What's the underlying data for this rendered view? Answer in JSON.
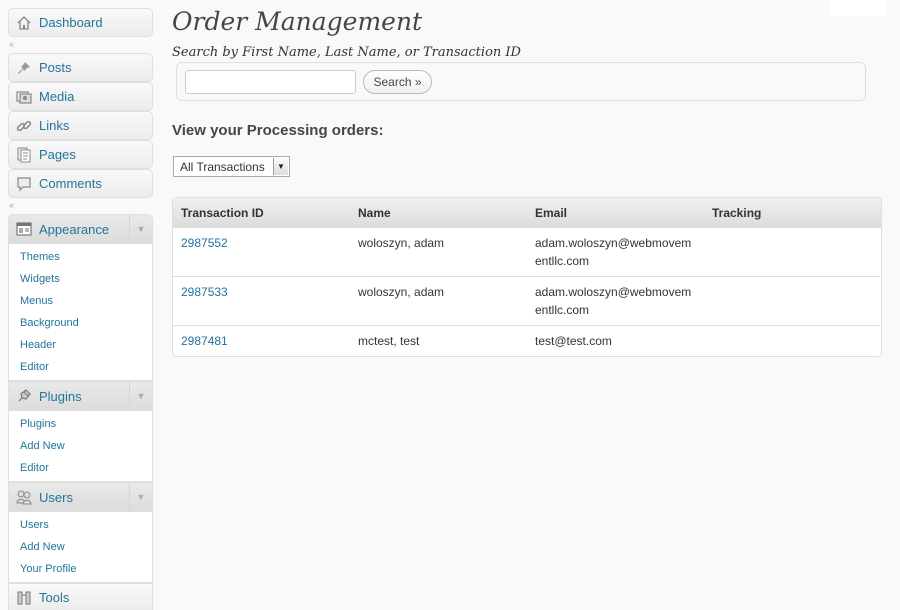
{
  "sidebar": {
    "dashboard": {
      "label": "Dashboard",
      "icon": "dashboard-icon"
    },
    "content": [
      {
        "label": "Posts",
        "icon": "pin-icon"
      },
      {
        "label": "Media",
        "icon": "media-icon"
      },
      {
        "label": "Links",
        "icon": "link-icon"
      },
      {
        "label": "Pages",
        "icon": "pages-icon"
      },
      {
        "label": "Comments",
        "icon": "comment-icon"
      }
    ],
    "appearance": {
      "label": "Appearance",
      "icon": "appearance-icon",
      "items": [
        "Themes",
        "Widgets",
        "Menus",
        "Background",
        "Header",
        "Editor"
      ]
    },
    "plugins": {
      "label": "Plugins",
      "icon": "plugin-icon",
      "items": [
        "Plugins",
        "Add New",
        "Editor"
      ]
    },
    "users": {
      "label": "Users",
      "icon": "users-icon",
      "items": [
        "Users",
        "Add New",
        "Your Profile"
      ]
    },
    "tools": {
      "label": "Tools",
      "icon": "tools-icon"
    }
  },
  "main": {
    "title": "Order Management",
    "search": {
      "label": "Search by First Name, Last Name, or Transaction ID",
      "input_value": "",
      "button_label": "Search »"
    },
    "section_heading": "View your Processing orders:",
    "filter": {
      "selected": "All Transactions"
    },
    "table": {
      "columns": [
        "Transaction ID",
        "Name",
        "Email",
        "Tracking"
      ],
      "rows": [
        {
          "transaction_id": "2987552",
          "name": "woloszyn, adam",
          "email": "adam.woloszyn@webmovementllc.com",
          "tracking": ""
        },
        {
          "transaction_id": "2987533",
          "name": "woloszyn, adam",
          "email": "adam.woloszyn@webmovementllc.com",
          "tracking": ""
        },
        {
          "transaction_id": "2987481",
          "name": "mctest, test",
          "email": "test@test.com",
          "tracking": ""
        }
      ]
    }
  },
  "colors": {
    "link": "#21759b",
    "text": "#333333",
    "background": "#f9f9f9",
    "border": "#dfdfdf"
  }
}
